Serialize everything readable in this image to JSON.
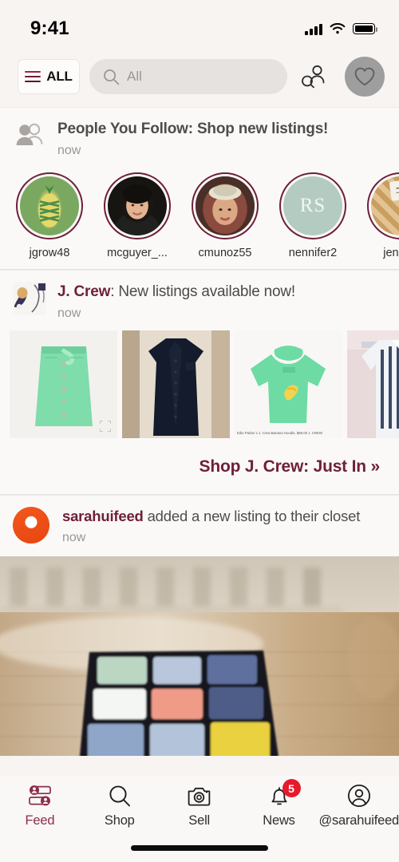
{
  "status_bar": {
    "time": "9:41",
    "signal_icon": "cellular-signal-icon",
    "wifi_icon": "wifi-icon",
    "battery_icon": "battery-full-icon"
  },
  "header": {
    "all_button_label": "ALL",
    "menu_icon": "hamburger-menu-icon",
    "search": {
      "placeholder": "All",
      "value": "",
      "icon": "search-icon"
    },
    "find_people_icon": "find-people-icon",
    "likes_icon": "heart-icon",
    "likes_active": true
  },
  "feed": {
    "people_you_follow": {
      "icon": "two-people-icon",
      "title": "People You Follow: Shop new listings!",
      "timestamp": "now",
      "people": [
        {
          "username": "jgrow48",
          "avatar": "pineapple-ornament-photo"
        },
        {
          "username": "mcguyer_...",
          "avatar": "woman-portrait-photo"
        },
        {
          "username": "cmunoz55",
          "avatar": "woman-with-visor-photo"
        },
        {
          "username": "nennifer2",
          "avatar": "monogram-rs"
        },
        {
          "username": "jenna_",
          "avatar": "product-photo"
        }
      ]
    },
    "brand_post": {
      "avatar": "jcrew-shoes-thumbnail",
      "brand": "J. Crew",
      "title_suffix": ": New listings available now!",
      "timestamp": "now",
      "listings": [
        {
          "alt": "mint-green-button-front-skirt",
          "watermark": "",
          "has_expand_icon": true
        },
        {
          "alt": "navy-button-down-shirt",
          "watermark": "",
          "has_expand_icon": false
        },
        {
          "alt": "mint-green-banana-hoodie",
          "watermark": "Edie Parker x J. Crew Banana Hoodie, $69.00   J. CREW",
          "has_expand_icon": false
        },
        {
          "alt": "blue-white-striped-dress",
          "watermark": "",
          "has_expand_icon": false
        }
      ],
      "shop_link": "Shop J. Crew: Just In »"
    },
    "user_post": {
      "avatar": "orange-circle-avatar",
      "username": "sarahuifeed",
      "action": " added a new listing to their closet",
      "timestamp": "now",
      "image_alt": "rubiks-cube-on-wooden-table"
    }
  },
  "tab_bar": {
    "tabs": [
      {
        "label": "Feed",
        "icon": "feed-icon",
        "active": true,
        "badge": ""
      },
      {
        "label": "Shop",
        "icon": "search-icon",
        "active": false,
        "badge": ""
      },
      {
        "label": "Sell",
        "icon": "camera-icon",
        "active": false,
        "badge": ""
      },
      {
        "label": "News",
        "icon": "bell-icon",
        "active": false,
        "badge": "5"
      },
      {
        "label": "@sarahuifeed",
        "icon": "person-circle-icon",
        "active": false,
        "badge": ""
      }
    ]
  },
  "colors": {
    "brand": "#6e1f39",
    "accent": "#8d2d4a",
    "badge": "#e8192c",
    "background": "#f7f4f2",
    "card": "#fbf9f8"
  }
}
